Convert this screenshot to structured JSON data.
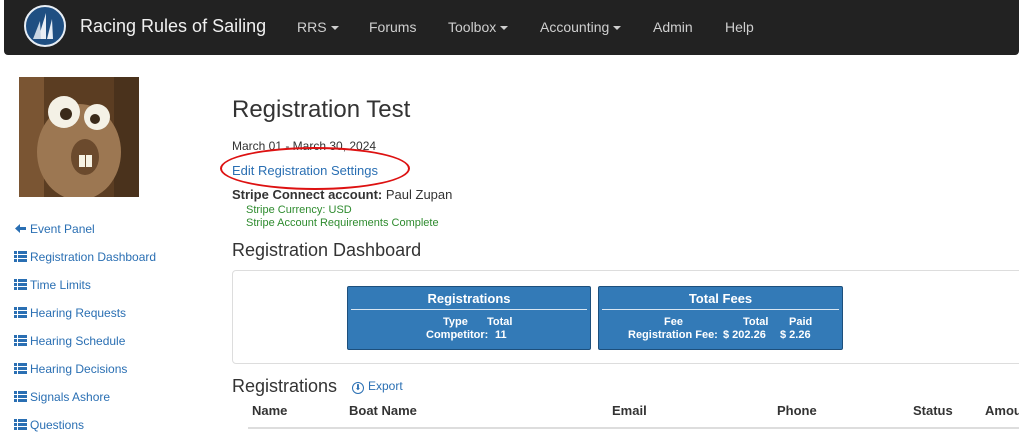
{
  "navbar": {
    "brand": "Racing Rules of Sailing",
    "items": [
      "RRS",
      "Forums",
      "Toolbox",
      "Accounting",
      "Admin",
      "Help"
    ]
  },
  "sidebar": {
    "items": [
      "Event Panel",
      "Registration Dashboard",
      "Time Limits",
      "Hearing Requests",
      "Hearing Schedule",
      "Hearing Decisions",
      "Signals Ashore",
      "Questions"
    ]
  },
  "main": {
    "title": "Registration Test",
    "dates": "March 01 - March 30, 2024",
    "edit_link": "Edit Registration Settings",
    "stripe_label": "Stripe Connect account:",
    "stripe_name": "Paul Zupan",
    "stripe_currency": "Stripe Currency: USD",
    "stripe_requirements": "Stripe Account Requirements Complete",
    "dashboard_heading": "Registration Dashboard",
    "registrations_card": {
      "title": "Registrations",
      "col_type": "Type",
      "col_total": "Total",
      "row_type": "Competitor:",
      "row_total": "11"
    },
    "fees_card": {
      "title": "Total Fees",
      "col_fee": "Fee",
      "col_total": "Total",
      "col_paid": "Paid",
      "row_fee": "Registration Fee:",
      "row_total": "$ 202.26",
      "row_paid": "$ 2.26"
    },
    "registrations_heading": "Registrations",
    "export_label": "Export",
    "table_headers": [
      "Name",
      "Boat Name",
      "Email",
      "Phone",
      "Status",
      "Amou"
    ]
  },
  "colors": {
    "navbar": "#222222",
    "link": "#2a6fb3",
    "card": "#337ab7",
    "highlight_oval": "#dd1111",
    "stripe_status": "#2e8b2e"
  }
}
